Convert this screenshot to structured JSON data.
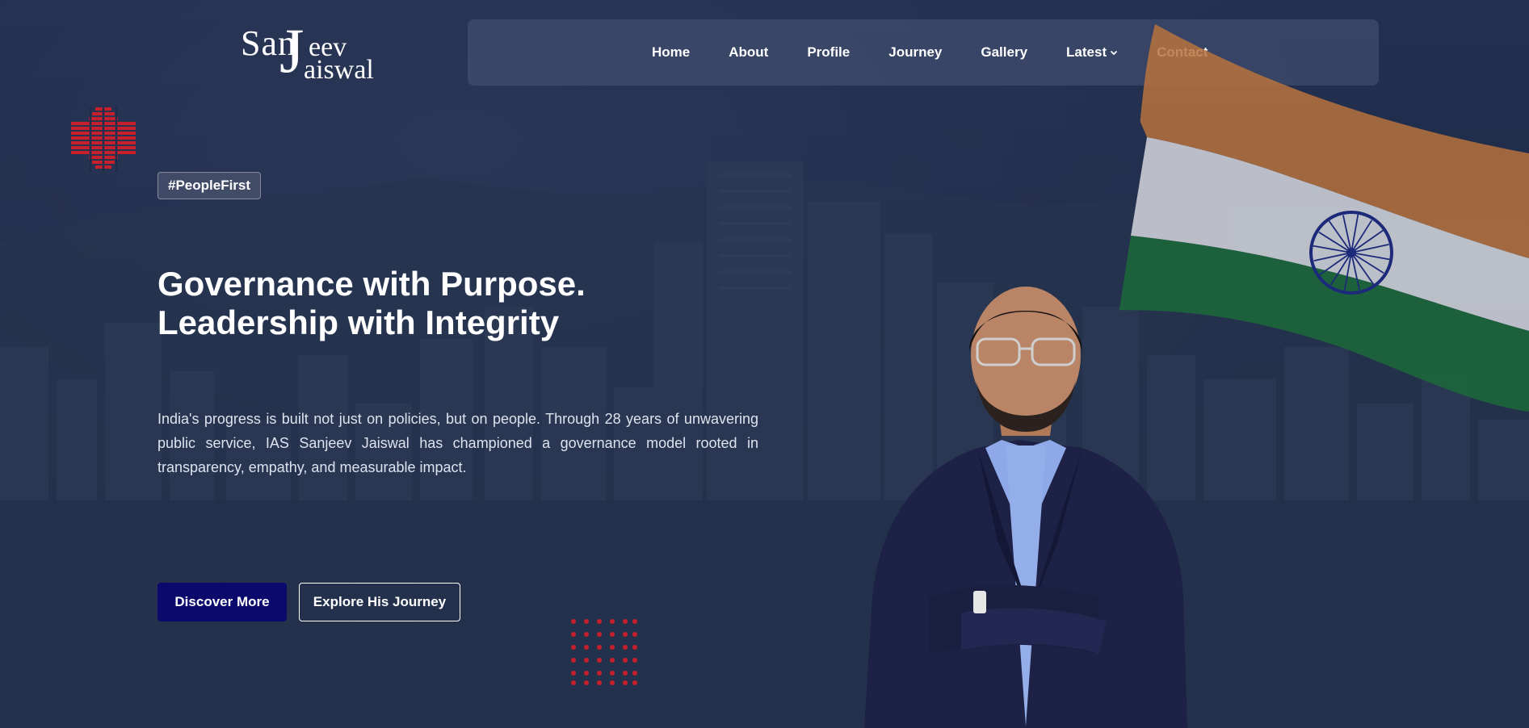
{
  "logo": {
    "line1": "San",
    "big_letter": "J",
    "line1_end": "eev",
    "line2": "aiswal"
  },
  "nav": {
    "items": [
      {
        "label": "Home"
      },
      {
        "label": "About"
      },
      {
        "label": "Profile"
      },
      {
        "label": "Journey"
      },
      {
        "label": "Gallery"
      },
      {
        "label": "Latest",
        "has_dropdown": true
      },
      {
        "label": "Contact"
      }
    ]
  },
  "hero": {
    "tag": "#PeopleFirst",
    "title_line1": "Governance with Purpose.",
    "title_line2": "Leadership with Integrity",
    "description": "India's progress is built not just on policies, but on people. Through 28 years of unwavering public service, IAS Sanjeev Jaiswal has championed a governance model rooted in transparency, empathy, and measurable impact.",
    "primary_button": "Discover More",
    "secondary_button": "Explore His Journey"
  },
  "colors": {
    "background": "#1f2b47",
    "primary_button": "#0b0a6c",
    "accent_red": "#c8202a",
    "flag_saffron": "#c87a3c",
    "flag_green": "#1c6a3a"
  }
}
